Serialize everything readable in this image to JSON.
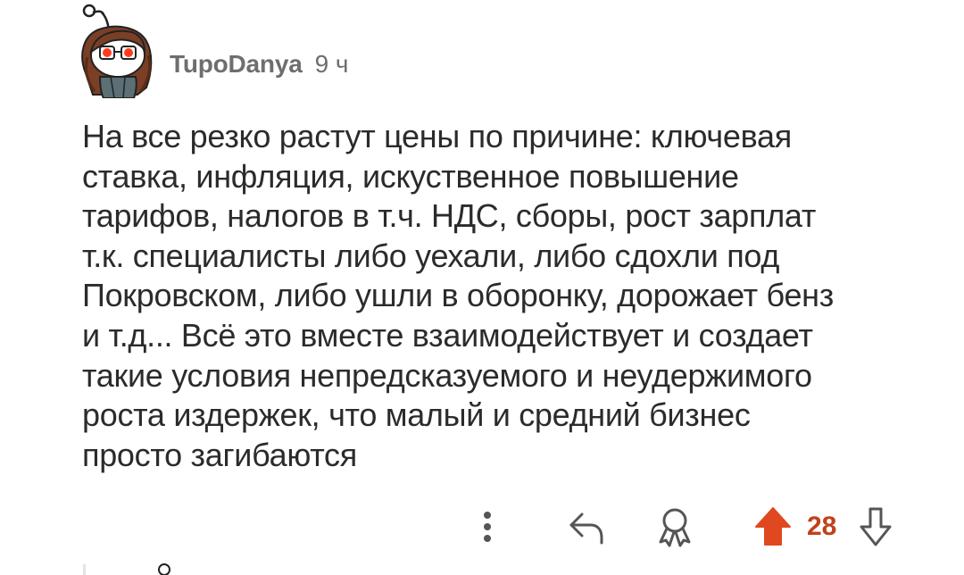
{
  "comment": {
    "author": "TupoDanya",
    "time": "9 ч",
    "body": "На все резко растут цены по причине: ключевая\nставка, инфляция, искуственное повышение\nтарифов, налогов в т.ч. НДС, сборы, рост зарплат\nт.к. специалисты либо уехали, либо сдохли под\nПокровском, либо ушли в оборонку, дорожает бенз\nи т.д... Всё это вместе взаимодействует и создает\nтакие условия непредсказуемого и неудержимого\nроста издержек, что малый и средний бизнес\nпросто загибаются",
    "score": "28"
  },
  "icons": {
    "more": "more-vertical-icon",
    "reply": "reply-icon",
    "award": "award-icon",
    "upvote": "upvote-arrow-icon",
    "downvote": "downvote-arrow-icon"
  },
  "colors": {
    "upvote": "#e0481f",
    "score": "#c0421a",
    "icon": "#555555",
    "meta": "#6e6e6e"
  }
}
